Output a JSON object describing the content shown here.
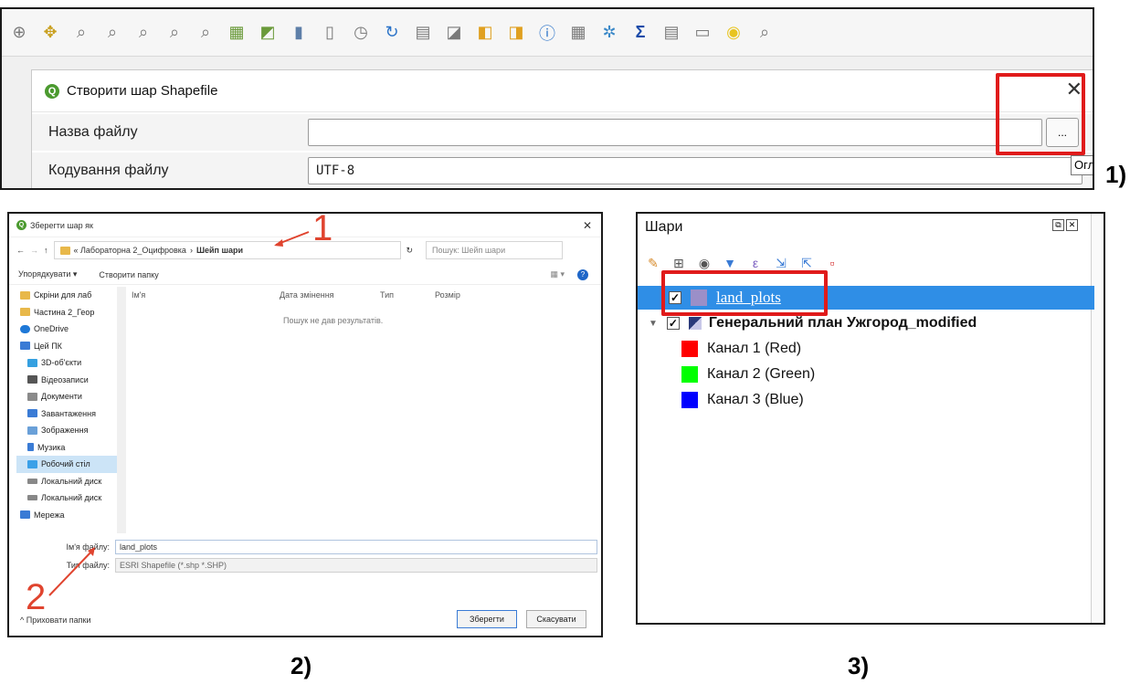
{
  "captions": {
    "one": "1)",
    "two": "2)",
    "three": "3)"
  },
  "annotations": {
    "arrow_one": "1",
    "arrow_two": "2"
  },
  "panel1": {
    "dialog_title": "Створити шар Shapefile",
    "close_glyph": "✕",
    "rows": {
      "file_name_label": "Назва файлу",
      "file_name_value": "",
      "browse_button": "...",
      "encoding_label": "Кодування файлу",
      "encoding_value": "UTF-8",
      "tooltip_fragment": "Огл"
    }
  },
  "panel2": {
    "title": "Зберегти шар як",
    "address": {
      "path_prefix": "« Лабораторна 2_Оцифровка",
      "path_current": "Шейп шари"
    },
    "search_placeholder": "Пошук: Шейп шари",
    "commands": {
      "organize": "Упорядкувати ▾",
      "new_folder": "Створити папку"
    },
    "nav_items": [
      {
        "label": "Скріни для лаб",
        "color": "#e8b84a"
      },
      {
        "label": "Частина 2_Геор",
        "color": "#e8b84a"
      },
      {
        "label": "OneDrive",
        "color": "#1e78d7"
      },
      {
        "label": "Цей ПК",
        "color": "#3a7bd5"
      },
      {
        "label": "3D-об'єкти",
        "color": "#35a0e0"
      },
      {
        "label": "Відеозаписи",
        "color": "#555555"
      },
      {
        "label": "Документи",
        "color": "#8a8a8a"
      },
      {
        "label": "Завантаження",
        "color": "#3a7bd5"
      },
      {
        "label": "Зображення",
        "color": "#6aa0d8"
      },
      {
        "label": "Музика",
        "color": "#3a7bd5"
      },
      {
        "label": "Робочий стіл",
        "color": "#3aa0e8"
      },
      {
        "label": "Локальний диск",
        "color": "#888888"
      },
      {
        "label": "Локальний диск",
        "color": "#888888"
      },
      {
        "label": "Мережа",
        "color": "#3a7bd5"
      }
    ],
    "columns": [
      "Ім'я",
      "Дата змінення",
      "Тип",
      "Розмір"
    ],
    "empty_text": "Пошук не дав результатів.",
    "file_name_label": "Ім'я файлу:",
    "file_name_value": "land_plots",
    "file_type_label": "Тип файлу:",
    "file_type_value": "ESRI Shapefile (*.shp *.SHP)",
    "hide_folders": "^ Приховати папки",
    "save_button": "Зберегти",
    "cancel_button": "Скасувати"
  },
  "panel3": {
    "header": "Шари",
    "layers": [
      {
        "label": "land_plots",
        "color": "#9b8fc8",
        "checked": "✓"
      },
      {
        "label": "Генеральний план Ужгород_modified",
        "checked": "✓"
      }
    ],
    "bands": [
      {
        "label": "Канал 1 (Red)",
        "color": "#ff0000"
      },
      {
        "label": "Канал 2 (Green)",
        "color": "#00ff00"
      },
      {
        "label": "Канал 3 (Blue)",
        "color": "#0000ff"
      }
    ]
  }
}
